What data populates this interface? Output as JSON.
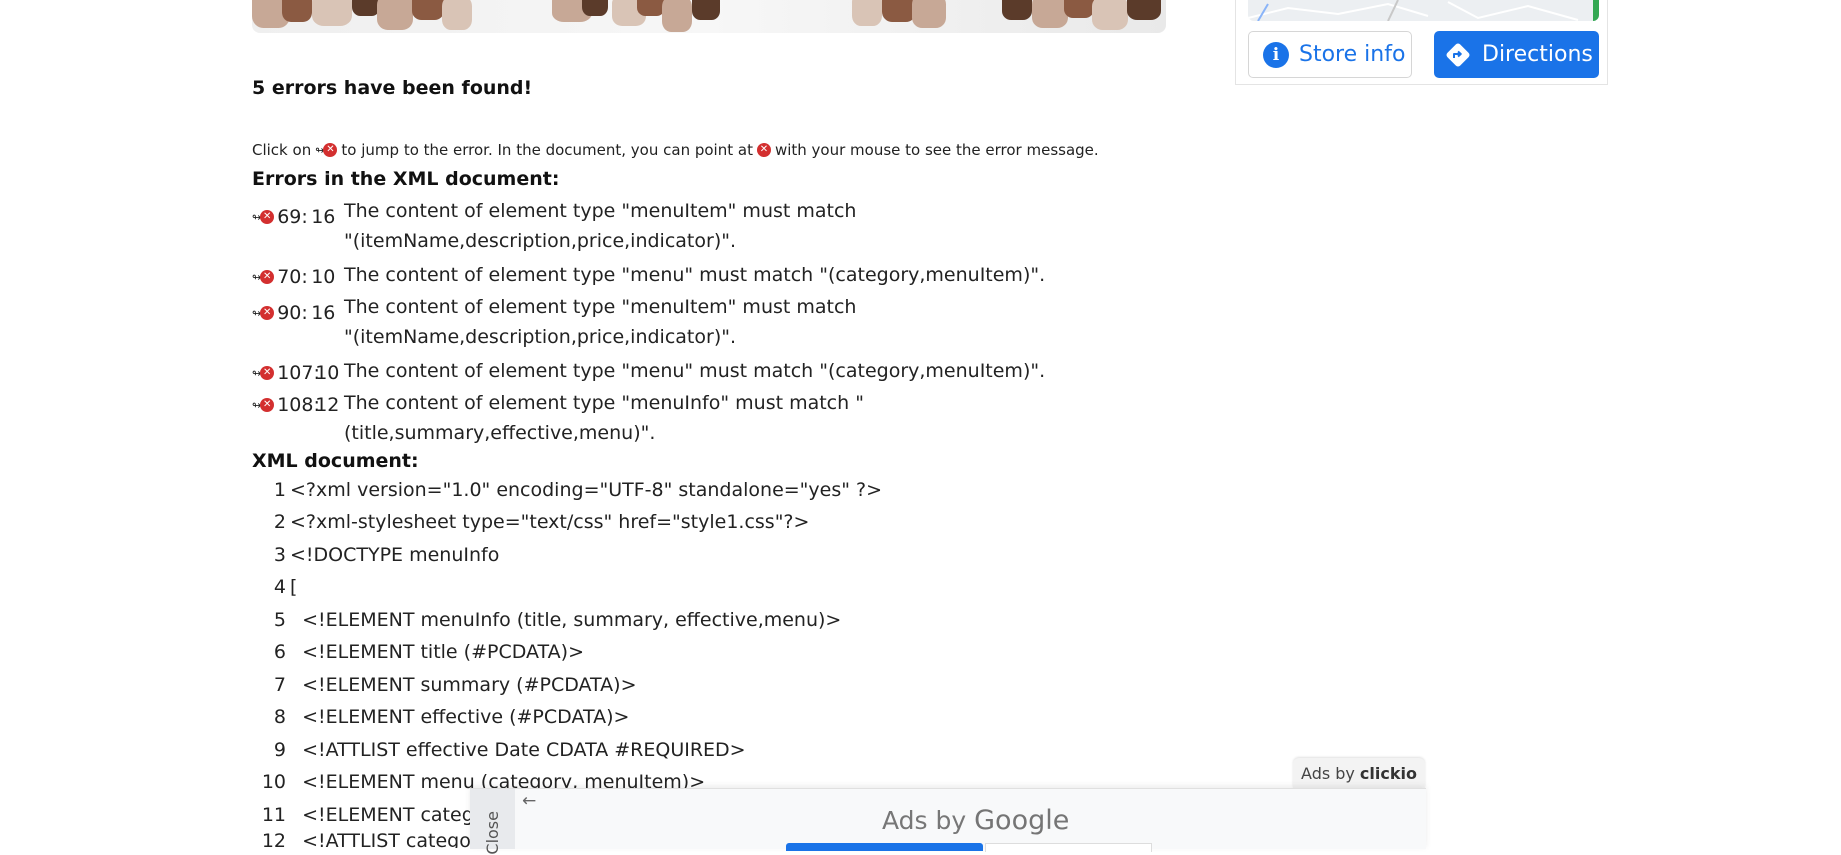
{
  "store": {
    "store_info_label": "Store info",
    "directions_label": "Directions",
    "info_icon": "info-icon",
    "directions_icon": "directions-icon",
    "accent_color": "#1a73e8"
  },
  "report": {
    "found_heading": "5 errors have been found!",
    "hint": {
      "part1": "Click on",
      "part2": "to jump to the error. In the document, you can point at",
      "part3": "with your mouse to see the error message."
    },
    "errors_heading": "Errors in the XML document:",
    "error_icon_glyph": "✕",
    "jump_arrow_glyph": "↬",
    "errors": [
      {
        "line": "69:",
        "col": "16",
        "message": "The content of element type \"menuItem\" must match \"(itemName,description,price,indicator)\"."
      },
      {
        "line": "70:",
        "col": "10",
        "message": "The content of element type \"menu\" must match \"(category,menuItem)\"."
      },
      {
        "line": "90:",
        "col": "16",
        "message": "The content of element type \"menuItem\" must match \"(itemName,description,price,indicator)\"."
      },
      {
        "line": "107:",
        "col": "10",
        "message": "The content of element type \"menu\" must match \"(category,menuItem)\"."
      },
      {
        "line": "108:",
        "col": "12",
        "message": "The content of element type \"menuInfo\" must match \"(title,summary,effective,menu)\"."
      }
    ]
  },
  "xml": {
    "heading": "XML document:",
    "lines": [
      {
        "n": "1",
        "text": "<?xml version=\"1.0\" encoding=\"UTF-8\" standalone=\"yes\" ?>"
      },
      {
        "n": "2",
        "text": "<?xml-stylesheet type=\"text/css\" href=\"style1.css\"?>"
      },
      {
        "n": "3",
        "text": "<!DOCTYPE menuInfo"
      },
      {
        "n": "4",
        "text": "["
      },
      {
        "n": "5",
        "text": "  <!ELEMENT menuInfo (title, summary, effective,menu)>"
      },
      {
        "n": "6",
        "text": "  <!ELEMENT title (#PCDATA)>"
      },
      {
        "n": "7",
        "text": "  <!ELEMENT summary (#PCDATA)>"
      },
      {
        "n": "8",
        "text": "  <!ELEMENT effective (#PCDATA)>"
      },
      {
        "n": "9",
        "text": "  <!ATTLIST effective Date CDATA #REQUIRED>"
      },
      {
        "n": "10",
        "text": "  <!ELEMENT menu (category, menuItem)>"
      },
      {
        "n": "11",
        "text": "  <!ELEMENT category"
      },
      {
        "n": "12",
        "text": "  <!ATTLIST category"
      }
    ]
  },
  "ads": {
    "ads_by_label": "Ads by",
    "clickio_label": "clickio",
    "ads_by_google_prefix": "Ads by",
    "google_label": "Google",
    "close_label": "Close",
    "back_arrow": "←"
  }
}
